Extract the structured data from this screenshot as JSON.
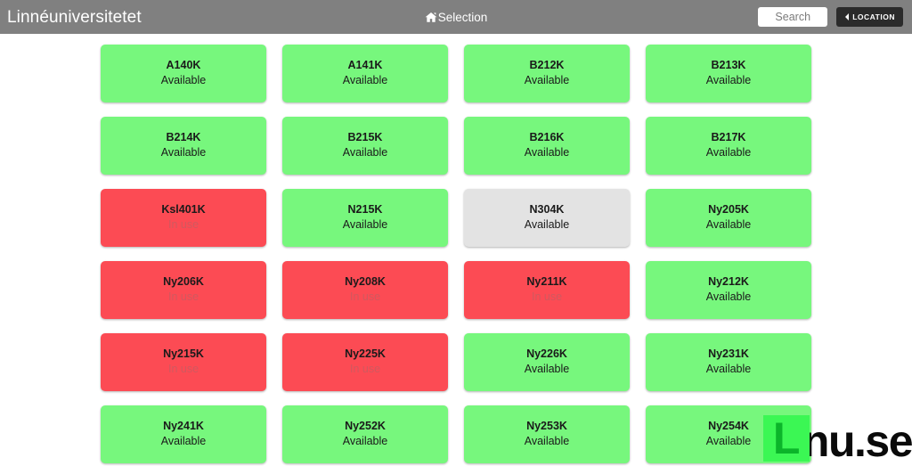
{
  "header": {
    "brand": "Linnéuniversitetet",
    "nav_link_label": "Selection",
    "home_icon": "home-icon",
    "search": {
      "value": "",
      "placeholder": "Search"
    },
    "location_button": {
      "label": "LOCATION",
      "icon": "chevron-left-icon"
    },
    "background_color": "#808080"
  },
  "colors": {
    "available": "#77f77d",
    "in_use": "#fc4b54",
    "muted": "#e3e3e3",
    "header": "#808080",
    "logo_green": "#3bf754",
    "logo_dark_green": "#0bb52a"
  },
  "status_labels": {
    "available": "Available",
    "in_use": "In use"
  },
  "rooms": [
    {
      "name": "A140K",
      "status": "Available",
      "state": "available"
    },
    {
      "name": "A141K",
      "status": "Available",
      "state": "available"
    },
    {
      "name": "B212K",
      "status": "Available",
      "state": "available"
    },
    {
      "name": "B213K",
      "status": "Available",
      "state": "available"
    },
    {
      "name": "B214K",
      "status": "Available",
      "state": "available"
    },
    {
      "name": "B215K",
      "status": "Available",
      "state": "available"
    },
    {
      "name": "B216K",
      "status": "Available",
      "state": "available"
    },
    {
      "name": "B217K",
      "status": "Available",
      "state": "available"
    },
    {
      "name": "Ksl401K",
      "status": "In use",
      "state": "inuse"
    },
    {
      "name": "N215K",
      "status": "Available",
      "state": "available"
    },
    {
      "name": "N304K",
      "status": "Available",
      "state": "muted"
    },
    {
      "name": "Ny205K",
      "status": "Available",
      "state": "available"
    },
    {
      "name": "Ny206K",
      "status": "In use",
      "state": "inuse"
    },
    {
      "name": "Ny208K",
      "status": "In use",
      "state": "inuse"
    },
    {
      "name": "Ny211K",
      "status": "In use",
      "state": "inuse"
    },
    {
      "name": "Ny212K",
      "status": "Available",
      "state": "available"
    },
    {
      "name": "Ny215K",
      "status": "In use",
      "state": "inuse"
    },
    {
      "name": "Ny225K",
      "status": "In use",
      "state": "inuse"
    },
    {
      "name": "Ny226K",
      "status": "Available",
      "state": "available"
    },
    {
      "name": "Ny231K",
      "status": "Available",
      "state": "available"
    },
    {
      "name": "Ny241K",
      "status": "Available",
      "state": "available"
    },
    {
      "name": "Ny252K",
      "status": "Available",
      "state": "available"
    },
    {
      "name": "Ny253K",
      "status": "Available",
      "state": "available"
    },
    {
      "name": "Ny254K",
      "status": "Available",
      "state": "available"
    }
  ],
  "footer": {
    "logo_letter": "L",
    "logo_text": "nu.se"
  }
}
